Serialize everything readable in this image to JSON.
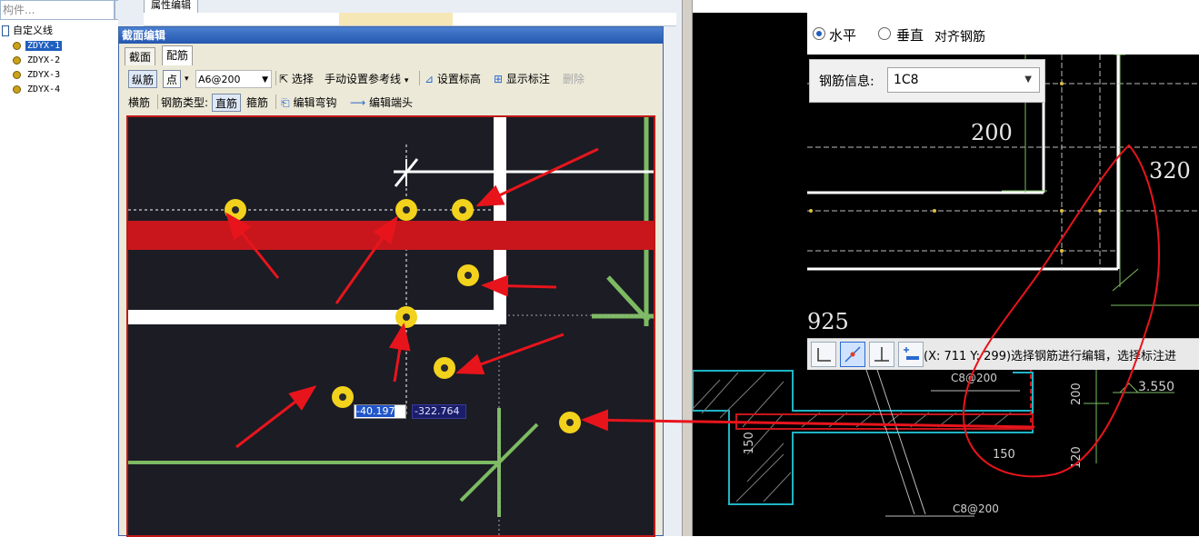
{
  "left_panel": {
    "search_placeholder": "构件...",
    "search_icon": "magnifier-icon",
    "tree_root": "自定义线",
    "tree_items": [
      "ZDYX-1",
      "ZDYX-2",
      "ZDYX-3",
      "ZDYX-4"
    ],
    "selected_item": "ZDYX-1"
  },
  "background_window": {
    "tab_label": "属性编辑"
  },
  "dialog": {
    "title": "截面编辑",
    "tabs": [
      "截面",
      "配筋"
    ],
    "active_tab": "配筋",
    "toolbar1": {
      "longitudinal_btn": "纵筋",
      "point_btn": "点",
      "rebar_value": "A6@200",
      "select_label": "选择",
      "ref_line_label": "手动设置参考线",
      "set_elevation_label": "设置标高",
      "show_annotation_label": "显示标注",
      "delete_label": "删除"
    },
    "toolbar2": {
      "transverse_label": "横筋",
      "rebar_type_label": "钢筋类型:",
      "straight_btn": "直筋",
      "stirrup_label": "箍筋",
      "edit_hook_label": "编辑弯钩",
      "edit_end_label": "编辑端头"
    },
    "coord_x": "-40.197",
    "coord_y": "-322.764"
  },
  "cad": {
    "radio_horizontal": "水平",
    "radio_vertical": "垂直",
    "align_label": "对齐钢筋",
    "rebar_info_label": "钢筋信息:",
    "rebar_info_value": "1C8",
    "dims": {
      "d200": "200",
      "d320": "320",
      "d925": "925",
      "c8_top": "C8@200",
      "c8_bottom": "C8@200",
      "d3550": "3.550",
      "d200_vertical": "200",
      "d150_left": "150",
      "d150_bottom": "150",
      "d120": "120"
    },
    "status_text": "(X: 711 Y: 299)选择钢筋进行编辑，选择标注进",
    "snap_icons": [
      "ortho-icon",
      "midpoint-snap-icon",
      "perpendicular-icon",
      "add-rebar-icon"
    ]
  },
  "colors": {
    "dialog_title_bg": "#2457b0",
    "canvas_bg": "#1b1c24",
    "rebar_red": "#c8161c",
    "marker_yellow": "#f2d21c",
    "green_line": "#7dbb62",
    "annotation_red": "#e8141c"
  }
}
